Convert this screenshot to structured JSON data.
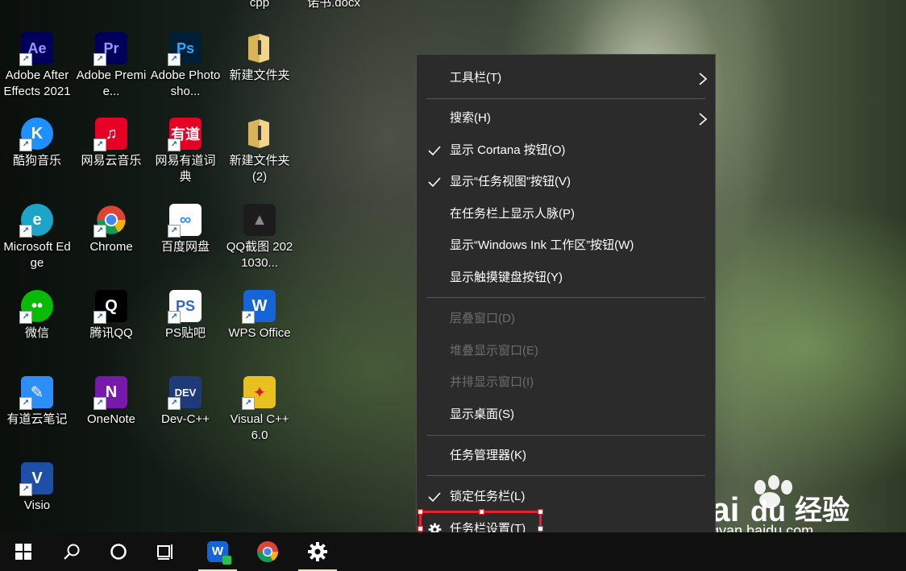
{
  "desktop": {
    "top_partial": [
      {
        "label": "cpp"
      },
      {
        "label": "诺书.docx"
      }
    ],
    "icons": [
      {
        "label": "Adobe After Effects 2021",
        "icon": "after-effects-icon",
        "glyph": "Ae",
        "bg": "#00005b",
        "fg": "#9999ff"
      },
      {
        "label": "Adobe Premie...",
        "icon": "premiere-icon",
        "glyph": "Pr",
        "bg": "#00005b",
        "fg": "#9999ff"
      },
      {
        "label": "Adobe Photosho...",
        "icon": "photoshop-icon",
        "glyph": "Ps",
        "bg": "#001e36",
        "fg": "#31a8ff"
      },
      {
        "label": "新建文件夹",
        "icon": "folder-icon",
        "glyph": "",
        "bg": "#e6c36a",
        "fg": "#fff"
      },
      {
        "label": "酷狗音乐",
        "icon": "kugou-icon",
        "glyph": "K",
        "bg": "#1e90ff",
        "fg": "#ffffff"
      },
      {
        "label": "网易云音乐",
        "icon": "netease-music-icon",
        "glyph": "♫",
        "bg": "#e60026",
        "fg": "#ffffff"
      },
      {
        "label": "网易有道词典",
        "icon": "youdao-dict-icon",
        "glyph": "有道",
        "bg": "#e60026",
        "fg": "#ffffff"
      },
      {
        "label": "新建文件夹 (2)",
        "icon": "folder-icon",
        "glyph": "",
        "bg": "#e6c36a",
        "fg": "#fff"
      },
      {
        "label": "Microsoft Edge",
        "icon": "edge-icon",
        "glyph": "e",
        "bg": "#1aa5c9",
        "fg": "#ffffff"
      },
      {
        "label": "Chrome",
        "icon": "chrome-icon",
        "glyph": "",
        "bg": "#ffffff",
        "fg": "#ffffff"
      },
      {
        "label": "百度网盘",
        "icon": "baidu-netdisk-icon",
        "glyph": "∞",
        "bg": "#ffffff",
        "fg": "#2e8ef7"
      },
      {
        "label": "QQ截图 2021030...",
        "icon": "screenshot-file-icon",
        "glyph": "▲",
        "bg": "#1c1c1c",
        "fg": "#888888"
      },
      {
        "label": "微信",
        "icon": "wechat-icon",
        "glyph": "••",
        "bg": "#09bb07",
        "fg": "#ffffff"
      },
      {
        "label": "腾讯QQ",
        "icon": "qq-icon",
        "glyph": "Q",
        "bg": "#000000",
        "fg": "#ffffff"
      },
      {
        "label": "PS贴吧",
        "icon": "tieba-icon",
        "glyph": "PS",
        "bg": "#ffffff",
        "fg": "#2e64d6"
      },
      {
        "label": "WPS Office",
        "icon": "wps-icon",
        "glyph": "W",
        "bg": "#1565d8",
        "fg": "#ffffff"
      },
      {
        "label": "有道云笔记",
        "icon": "youdao-note-icon",
        "glyph": "✎",
        "bg": "#2e8ef7",
        "fg": "#ffffff"
      },
      {
        "label": "OneNote",
        "icon": "onenote-icon",
        "glyph": "N",
        "bg": "#7719aa",
        "fg": "#ffffff"
      },
      {
        "label": "Dev-C++",
        "icon": "devcpp-icon",
        "glyph": "DEV",
        "bg": "#1e3a78",
        "fg": "#ffffff"
      },
      {
        "label": "Visual C++ 6.0",
        "icon": "visual-cpp-icon",
        "glyph": "✦",
        "bg": "#e8c020",
        "fg": "#d02020"
      },
      {
        "label": "Visio",
        "icon": "visio-icon",
        "glyph": "V",
        "bg": "#1e4fa8",
        "fg": "#ffffff"
      }
    ]
  },
  "context_menu": {
    "items": [
      {
        "label": "工具栏(T)",
        "checked": false,
        "submenu": true,
        "disabled": false
      },
      {
        "label": "搜索(H)",
        "checked": false,
        "submenu": true,
        "disabled": false
      },
      {
        "label": "显示 Cortana 按钮(O)",
        "checked": true,
        "submenu": false,
        "disabled": false
      },
      {
        "label": "显示“任务视图”按钮(V)",
        "checked": true,
        "submenu": false,
        "disabled": false
      },
      {
        "label": "在任务栏上显示人脉(P)",
        "checked": false,
        "submenu": false,
        "disabled": false
      },
      {
        "label": "显示“Windows Ink 工作区”按钮(W)",
        "checked": false,
        "submenu": false,
        "disabled": false
      },
      {
        "label": "显示触摸键盘按钮(Y)",
        "checked": false,
        "submenu": false,
        "disabled": false
      },
      {
        "label": "层叠窗口(D)",
        "checked": false,
        "submenu": false,
        "disabled": true
      },
      {
        "label": "堆叠显示窗口(E)",
        "checked": false,
        "submenu": false,
        "disabled": true
      },
      {
        "label": "并排显示窗口(I)",
        "checked": false,
        "submenu": false,
        "disabled": true
      },
      {
        "label": "显示桌面(S)",
        "checked": false,
        "submenu": false,
        "disabled": false
      },
      {
        "label": "任务管理器(K)",
        "checked": false,
        "submenu": false,
        "disabled": false
      },
      {
        "label": "锁定任务栏(L)",
        "checked": true,
        "submenu": false,
        "disabled": false
      },
      {
        "label": "任务栏设置(T)",
        "checked": false,
        "submenu": false,
        "disabled": false,
        "gear": true
      }
    ]
  },
  "taskbar": {
    "items": [
      {
        "name": "start-button",
        "icon": "windows-logo-icon"
      },
      {
        "name": "search-button",
        "icon": "search-icon"
      },
      {
        "name": "cortana-button",
        "icon": "cortana-circle-icon"
      },
      {
        "name": "task-view-button",
        "icon": "task-view-icon"
      },
      {
        "name": "taskbar-wps-app",
        "icon": "wps-icon",
        "active": true
      },
      {
        "name": "taskbar-chrome-app",
        "icon": "chrome-icon",
        "active": false
      },
      {
        "name": "taskbar-settings-app",
        "icon": "gear-icon",
        "active": true
      }
    ]
  },
  "watermark": {
    "brand_bai": "Bai",
    "brand_du": "du",
    "brand_cn": "经验",
    "url": "jingyan.baidu.com"
  },
  "colors": {
    "menu_bg": "#2b2b2b",
    "highlight": "#e8202a",
    "taskbar_bg": "#101010"
  }
}
